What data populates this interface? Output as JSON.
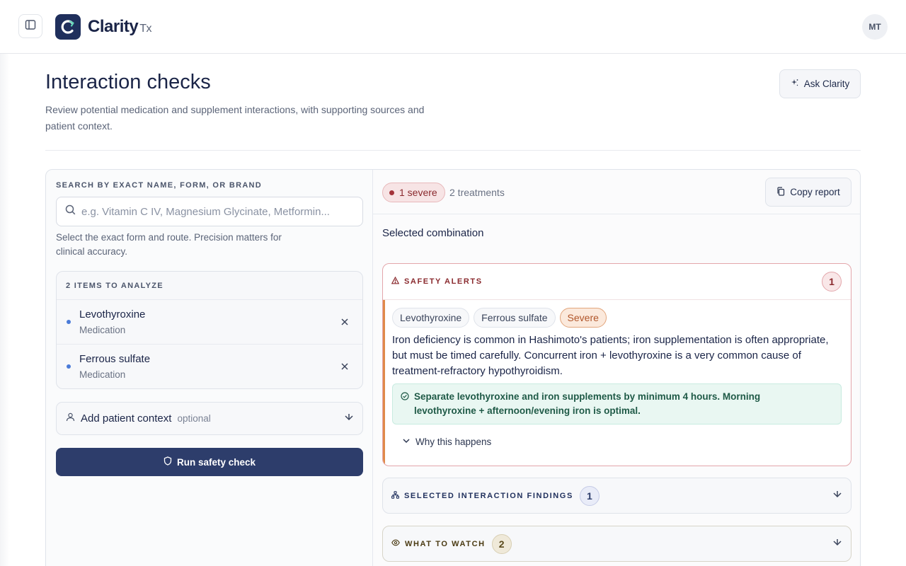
{
  "header": {
    "brand": "Clarity",
    "brand_suffix": "Tx",
    "avatar_initials": "MT"
  },
  "page": {
    "title": "Interaction checks",
    "subtitle": "Review potential medication and supplement interactions, with supporting sources and patient context.",
    "ask_button": "Ask Clarity"
  },
  "search": {
    "label": "SEARCH BY EXACT NAME, FORM, OR BRAND",
    "placeholder": "e.g. Vitamin C IV, Magnesium Glycinate, Metformin...",
    "value": "",
    "help": "Select the exact form and route. Precision matters for clinical accuracy."
  },
  "items": {
    "header": "2 ITEMS TO ANALYZE",
    "list": [
      {
        "name": "Levothyroxine",
        "type": "Medication"
      },
      {
        "name": "Ferrous sulfate",
        "type": "Medication"
      }
    ]
  },
  "context": {
    "label": "Add patient context",
    "optional": "optional"
  },
  "run_button": "Run safety check",
  "summary": {
    "severe_badge": "1 severe",
    "treatments": "2 treatments",
    "copy_button": "Copy report"
  },
  "combination_title": "Selected combination",
  "safety_alerts": {
    "title": "SAFETY ALERTS",
    "count": "1",
    "chips": [
      "Levothyroxine",
      "Ferrous sulfate"
    ],
    "severity": "Severe",
    "text": "Iron deficiency is common in Hashimoto's patients; iron supplementation is often appropriate, but must be timed carefully. Concurrent iron + levothyroxine is a very common cause of treatment-refractory hypothyroidism.",
    "recommendation": "Separate levothyroxine and iron supplements by minimum 4 hours. Morning levothyroxine + afternoon/evening iron is optimal.",
    "why_label": "Why this happens"
  },
  "findings": {
    "title": "SELECTED INTERACTION FINDINGS",
    "count": "1"
  },
  "watch": {
    "title": "WHAT TO WATCH",
    "count": "2"
  },
  "colors": {
    "brand_navy": "#1f2f5c",
    "run_button": "#2d3d6b",
    "severe_red": "#8a2a2e",
    "severe_orange": "#b0552a",
    "accent_orange": "#e08a4a",
    "recommend_green": "#1f5a47"
  },
  "icons": {
    "sidebar_toggle": "sidebar-icon",
    "logo": "clarity-logo-icon",
    "ask": "sparkle-icon",
    "search": "search-icon",
    "remove": "close-icon",
    "context": "person-icon",
    "context_chevron": "chevron-down-icon",
    "run": "shield-icon",
    "copy": "copy-icon",
    "alert": "warning-triangle-icon",
    "recommend": "check-circle-icon",
    "why": "chevron-down-icon",
    "findings": "network-icon",
    "watch": "eye-icon"
  }
}
